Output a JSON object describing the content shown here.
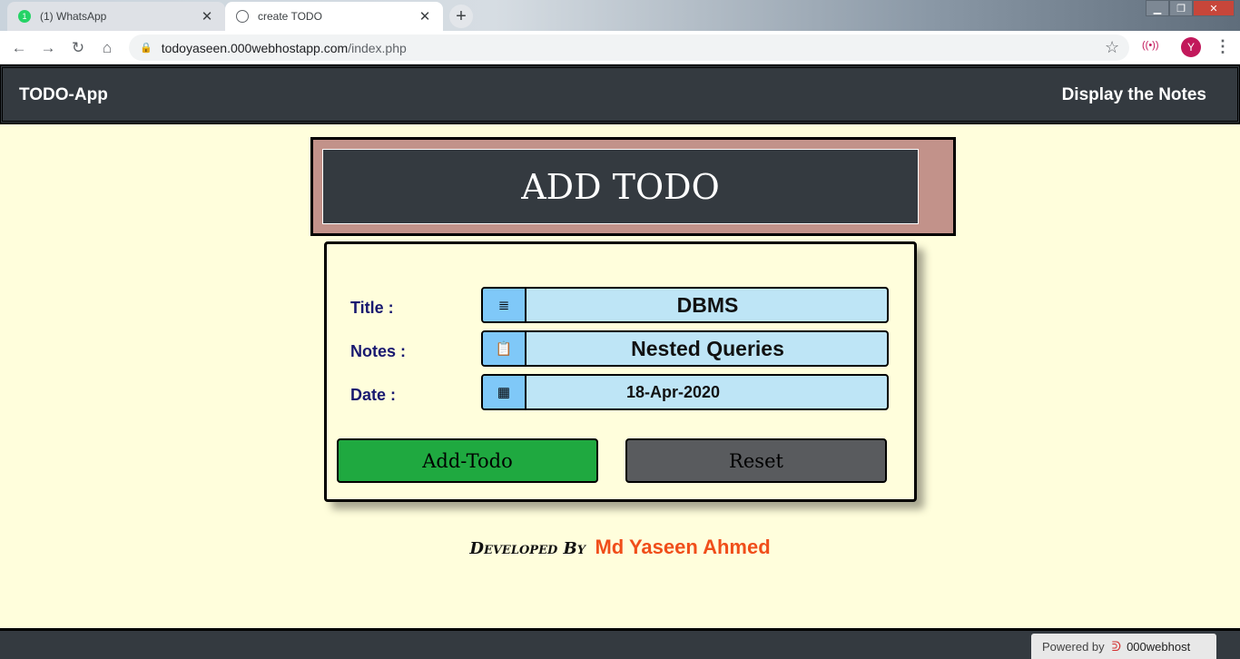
{
  "browser": {
    "tabs": [
      {
        "title": "(1) WhatsApp",
        "badge": "1",
        "active": false
      },
      {
        "title": "create TODO",
        "active": true
      }
    ],
    "new_tab": "+",
    "url_host": "todoyaseen.000webhostapp.com",
    "url_path": "/index.php",
    "profile_initial": "Y"
  },
  "navbar": {
    "brand": "TODO-App",
    "link": "Display the Notes"
  },
  "header": {
    "title": "ADD TODO"
  },
  "form": {
    "title_label": "Title :",
    "title_value": "DBMS",
    "notes_label": "Notes :",
    "notes_value": "Nested Queries",
    "date_label": "Date :",
    "date_value": "18-Apr-2020",
    "add_button": "Add-Todo",
    "reset_button": "Reset"
  },
  "credit": {
    "developed_by": "Developed By",
    "author": "Md Yaseen Ahmed"
  },
  "footer": {
    "powered_by": "Powered by",
    "host_brand": "000webhost"
  },
  "icons": {
    "title_icon": "align-justify-icon",
    "notes_icon": "clipboard-plus-icon",
    "date_icon": "calendar-icon"
  },
  "colors": {
    "page_bg": "#fffedc",
    "navbar_bg": "#343a40",
    "header_frame": "#c2928a",
    "field_bg": "#bee5f6",
    "icon_bg": "#7fc8f8",
    "add_button": "#1fa940",
    "reset_button": "#595b5e",
    "author": "#f04e1a",
    "label": "#191970"
  }
}
